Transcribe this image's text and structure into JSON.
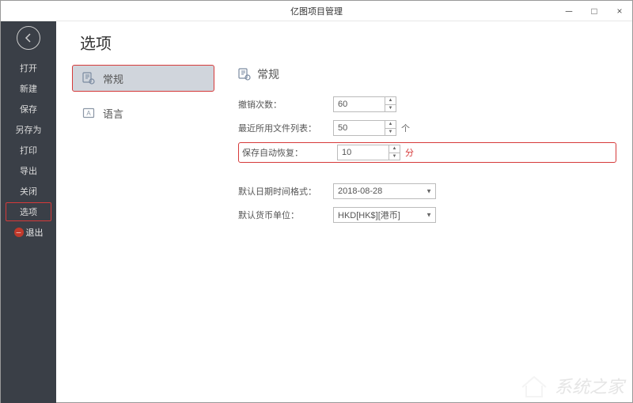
{
  "window": {
    "title": "亿图项目管理"
  },
  "sidebar": {
    "items": [
      {
        "label": "打开"
      },
      {
        "label": "新建"
      },
      {
        "label": "保存"
      },
      {
        "label": "另存为"
      },
      {
        "label": "打印"
      },
      {
        "label": "导出"
      },
      {
        "label": "关闭"
      },
      {
        "label": "选项"
      },
      {
        "label": "退出"
      }
    ]
  },
  "page": {
    "title": "选项"
  },
  "categories": {
    "general": "常规",
    "language": "语言"
  },
  "settings": {
    "section_title": "常规",
    "undo": {
      "label": "撤销次数：",
      "value": "60"
    },
    "recent": {
      "label": "最近所用文件列表：",
      "value": "50",
      "unit": "个"
    },
    "autosave": {
      "label": "保存自动恢复：",
      "value": "10",
      "unit": "分"
    },
    "dateformat": {
      "label": "默认日期时间格式：",
      "value": "2018-08-28"
    },
    "currency": {
      "label": "默认货币单位：",
      "value": "HKD[HK$][港币]"
    }
  },
  "watermark": "系统之家"
}
